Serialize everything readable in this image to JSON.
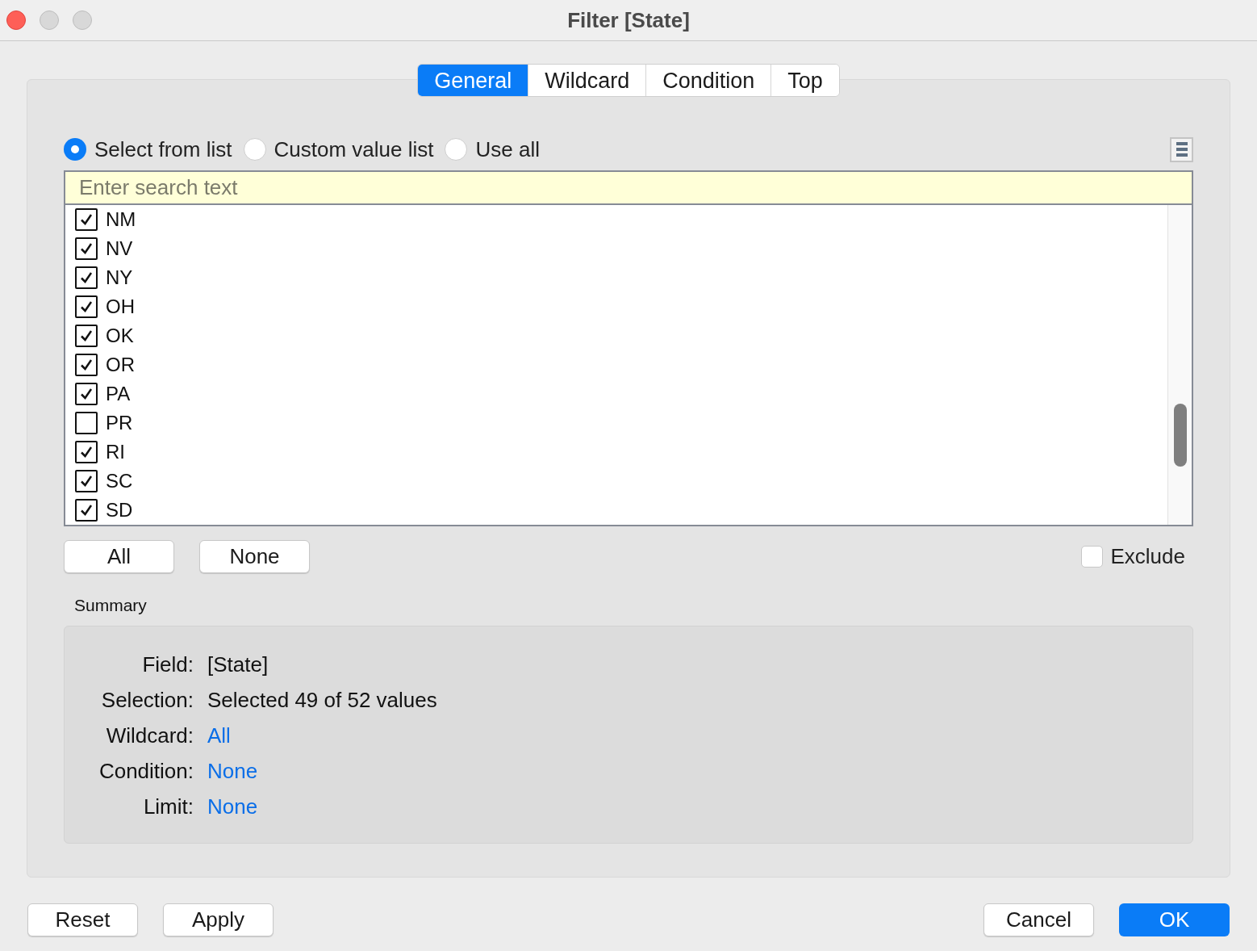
{
  "window": {
    "title": "Filter [State]"
  },
  "tabs": [
    {
      "label": "General",
      "selected": true
    },
    {
      "label": "Wildcard",
      "selected": false
    },
    {
      "label": "Condition",
      "selected": false
    },
    {
      "label": "Top",
      "selected": false
    }
  ],
  "source": [
    {
      "label": "Select from list",
      "selected": true
    },
    {
      "label": "Custom value list",
      "selected": false
    },
    {
      "label": "Use all",
      "selected": false
    }
  ],
  "search": {
    "placeholder": "Enter search text"
  },
  "values": [
    {
      "label": "NM",
      "checked": true
    },
    {
      "label": "NV",
      "checked": true
    },
    {
      "label": "NY",
      "checked": true
    },
    {
      "label": "OH",
      "checked": true
    },
    {
      "label": "OK",
      "checked": true
    },
    {
      "label": "OR",
      "checked": true
    },
    {
      "label": "PA",
      "checked": true
    },
    {
      "label": "PR",
      "checked": false
    },
    {
      "label": "RI",
      "checked": true
    },
    {
      "label": "SC",
      "checked": true
    },
    {
      "label": "SD",
      "checked": true
    }
  ],
  "list_buttons": [
    "All",
    "None"
  ],
  "exclude": {
    "label": "Exclude",
    "checked": false
  },
  "summary": {
    "heading": "Summary",
    "rows": [
      {
        "label": "Field:",
        "value": "[State]",
        "kind": "text"
      },
      {
        "label": "Selection:",
        "value": "Selected 49 of 52 values",
        "kind": "text"
      },
      {
        "label": "Wildcard:",
        "value": "All",
        "kind": "link"
      },
      {
        "label": "Condition:",
        "value": "None",
        "kind": "link"
      },
      {
        "label": "Limit:",
        "value": "None",
        "kind": "link"
      }
    ]
  },
  "footer_left": [
    "Reset",
    "Apply"
  ],
  "footer_right": [
    {
      "label": "Cancel",
      "kind": "default"
    },
    {
      "label": "OK",
      "kind": "primary"
    }
  ]
}
